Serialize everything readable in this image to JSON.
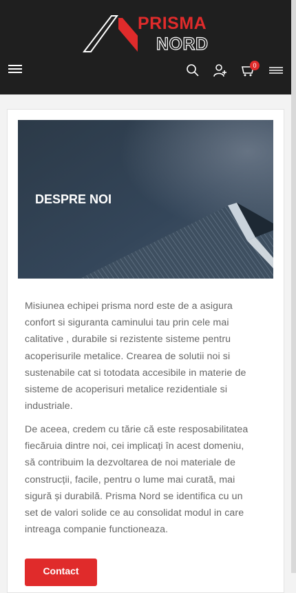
{
  "header": {
    "logo_top": "PRISMA",
    "logo_bottom": "NORD",
    "cart_count": "0",
    "icons": [
      "menu-icon",
      "search-icon",
      "user-add-icon",
      "cart-icon",
      "hamburger-icon"
    ]
  },
  "hero": {
    "title": "DESPRE NOI"
  },
  "content": {
    "paragraph1": "Misiunea echipei prisma nord este de a asigura confort si siguranta caminului tau prin cele mai calitative , durabile si rezistente sisteme pentru acoperisurile metalice. Crearea de solutii noi si sustenabile cat si totodata accesibile in materie de sisteme de acoperisuri metalice rezidentiale si industriale.",
    "paragraph2": "De aceea, credem cu tărie că este resposabilitatea fiecăruia dintre noi, cei implicați în acest domeniu, să contribuim la dezvoltarea de noi materiale de construcții, facile, pentru o lume mai curată, mai sigură și durabilă. Prisma Nord se identifica cu un set de valori solide ce au consolidat modul in care intreaga companie functioneaza.",
    "contact_button": "Contact"
  },
  "colors": {
    "header_bg": "#1f1f1f",
    "accent": "#e02b2b",
    "text": "#666666"
  }
}
